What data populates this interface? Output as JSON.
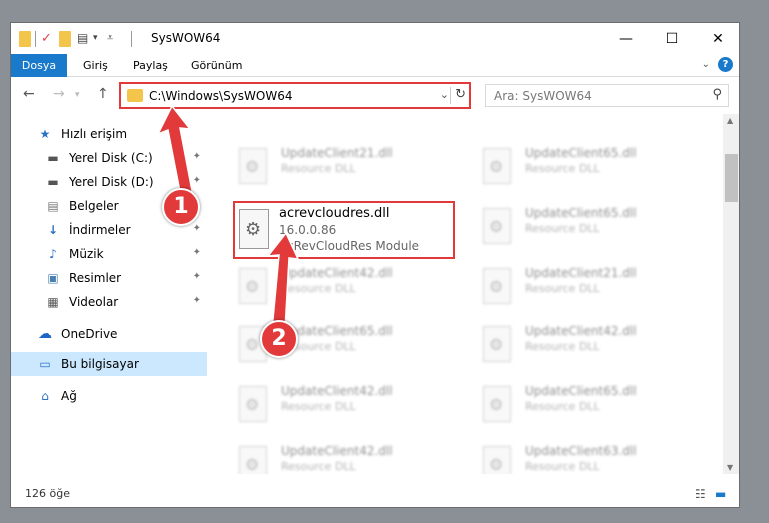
{
  "window": {
    "title": "SysWOW64",
    "minimize": "—",
    "maximize": "☐",
    "close": "✕"
  },
  "ribbon": {
    "tabs": [
      "Dosya",
      "Giriş",
      "Paylaş",
      "Görünüm"
    ],
    "help": "?"
  },
  "address": {
    "path": "C:\\Windows\\SysWOW64",
    "search_placeholder": "Ara: SysWOW64"
  },
  "sidebar": {
    "items": [
      {
        "label": "Hızlı erişim",
        "icon": "star-icon"
      },
      {
        "label": "Yerel Disk (C:)",
        "icon": "drive-icon"
      },
      {
        "label": "Yerel Disk (D:)",
        "icon": "drive-icon"
      },
      {
        "label": "Belgeler",
        "icon": "documents-icon"
      },
      {
        "label": "İndirmeler",
        "icon": "download-icon"
      },
      {
        "label": "Müzik",
        "icon": "music-icon"
      },
      {
        "label": "Resimler",
        "icon": "pictures-icon"
      },
      {
        "label": "Videolar",
        "icon": "videos-icon"
      },
      {
        "label": "OneDrive",
        "icon": "cloud-icon"
      },
      {
        "label": "Bu bilgisayar",
        "icon": "computer-icon"
      },
      {
        "label": "Ağ",
        "icon": "network-icon"
      }
    ]
  },
  "files": {
    "selected": {
      "name": "acrevcloudres.dll",
      "version": "16.0.0.86",
      "description": "AcRevCloudRes Module"
    },
    "tiles": [
      {
        "name": "UpdateClient21.dll",
        "type": "Resource DLL"
      },
      {
        "name": "UpdateClient65.dll",
        "type": "Resource DLL"
      },
      {
        "name": "UpdateClient65.dll",
        "type": "Resource DLL"
      },
      {
        "name": "UpdateClient42.dll",
        "type": "Resource DLL"
      },
      {
        "name": "UpdateClient21.dll",
        "type": "Resource DLL"
      },
      {
        "name": "UpdateClient65.dll",
        "type": "Resource DLL"
      },
      {
        "name": "UpdateClient42.dll",
        "type": "Resource DLL"
      },
      {
        "name": "UpdateClient42.dll",
        "type": "Resource DLL"
      },
      {
        "name": "UpdateClient65.dll",
        "type": "Resource DLL"
      },
      {
        "name": "UpdateClient42.dll",
        "type": "Resource DLL"
      },
      {
        "name": "UpdateClient63.dll",
        "type": "Resource DLL"
      }
    ]
  },
  "status": {
    "count": "126 öğe"
  },
  "callouts": [
    "1",
    "2"
  ],
  "colors": {
    "accent": "#1979ca",
    "highlight": "#e23a3a",
    "selected_nav": "#cce8ff"
  }
}
